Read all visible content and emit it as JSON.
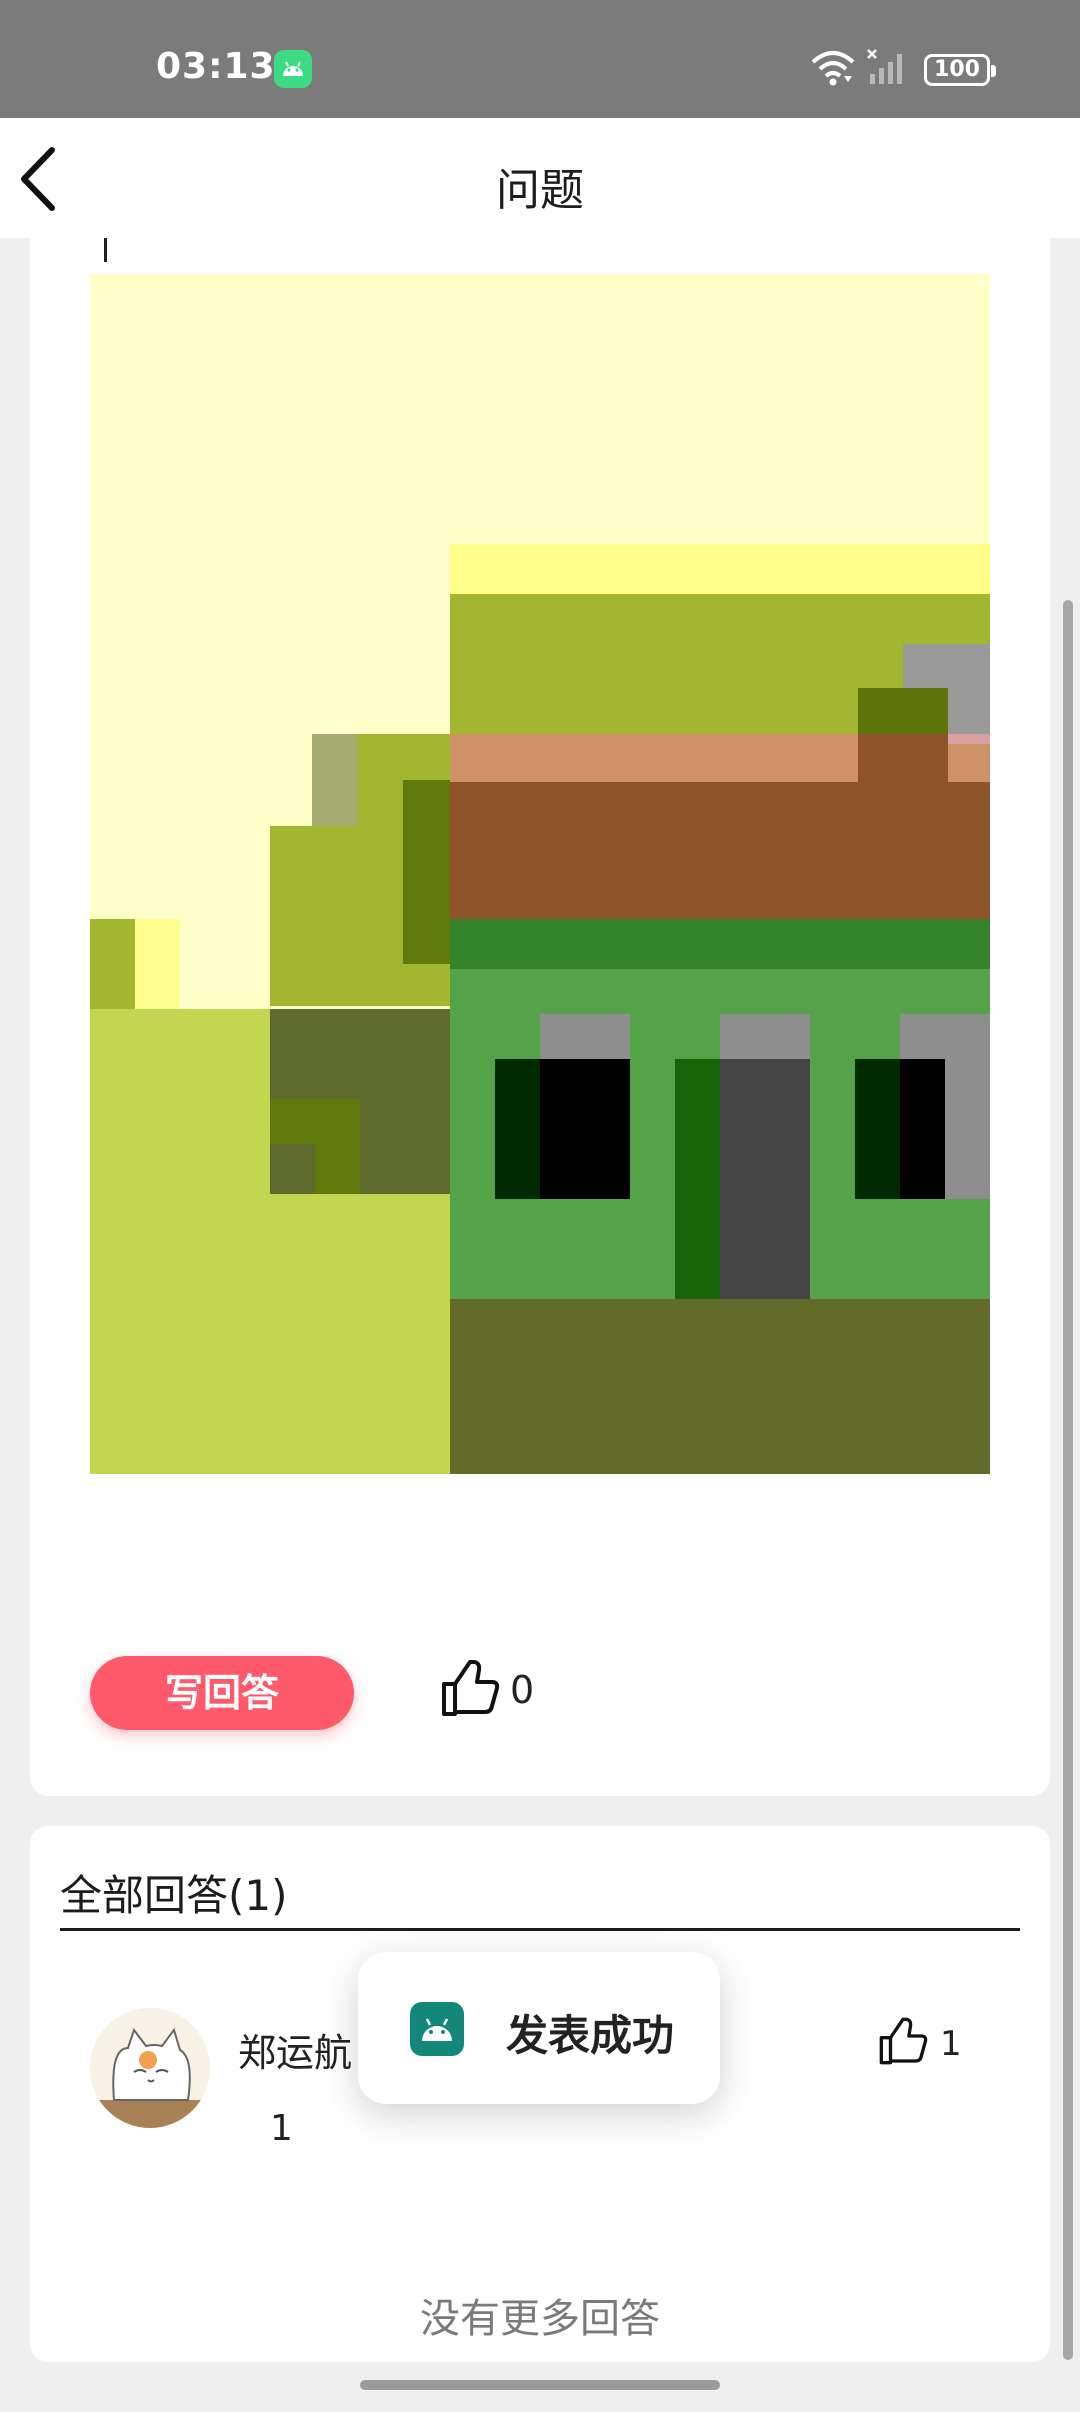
{
  "status_bar": {
    "time": "03:13",
    "battery": "100",
    "icons": [
      "android-app-icon",
      "wifi-icon",
      "signal-icon",
      "battery-icon"
    ]
  },
  "header": {
    "title": "问题",
    "back_icon": "back-arrow-icon"
  },
  "question": {
    "write_answer_label": "写回答",
    "like_count": "0",
    "like_icon": "thumbs-up-icon"
  },
  "answers": {
    "heading": "全部回答(1)",
    "items": [
      {
        "author": "郑运航",
        "content": "1",
        "likes": "1"
      }
    ],
    "no_more": "没有更多回答"
  },
  "toast": {
    "text": "发表成功",
    "icon": "android-app-icon"
  },
  "colors": {
    "accent": "#ff5a6c",
    "status_bar": "#7c7b7c",
    "background": "#efefef"
  }
}
